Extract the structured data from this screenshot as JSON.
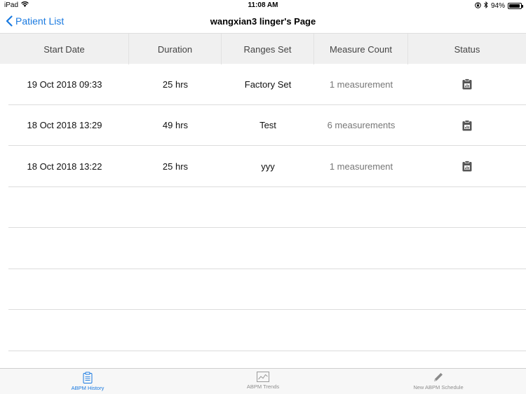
{
  "status_bar": {
    "device": "iPad",
    "time": "11:08 AM",
    "battery": "94%",
    "battery_level": 0.94
  },
  "nav": {
    "back_label": "Patient List",
    "title": "wangxian3 linger's Page"
  },
  "table": {
    "columns": [
      "Start Date",
      "Duration",
      "Ranges Set",
      "Measure Count",
      "Status"
    ],
    "rows": [
      {
        "start_date": "19 Oct 2018 09:33",
        "duration": "25 hrs",
        "ranges_set": "Factory Set",
        "measure_count": "1 measurement",
        "status_icon": "clipboard-icon"
      },
      {
        "start_date": "18 Oct 2018 13:29",
        "duration": "49 hrs",
        "ranges_set": "Test",
        "measure_count": "6 measurements",
        "status_icon": "clipboard-icon"
      },
      {
        "start_date": "18 Oct 2018 13:22",
        "duration": "25 hrs",
        "ranges_set": "yyy",
        "measure_count": "1 measurement",
        "status_icon": "clipboard-icon"
      }
    ]
  },
  "tabs": [
    {
      "label": "ABPM History",
      "icon": "clipboard-icon",
      "active": true
    },
    {
      "label": "ABPM Trends",
      "icon": "chart-icon",
      "active": false
    },
    {
      "label": "New ABPM Schedule",
      "icon": "pencil-icon",
      "active": false
    }
  ],
  "colors": {
    "accent": "#1a7ae0",
    "header_bg": "#f0f0f0",
    "tab_inactive": "#8e8e8e"
  }
}
